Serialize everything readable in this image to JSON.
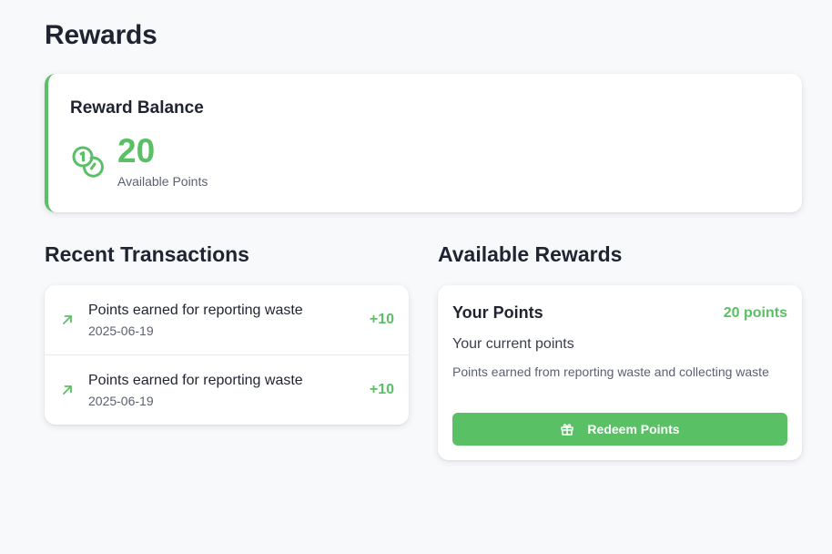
{
  "page": {
    "title": "Rewards"
  },
  "balance": {
    "title": "Reward Balance",
    "points": "20",
    "caption": "Available Points",
    "icon": "coins-icon",
    "accent_color": "#5ac066"
  },
  "transactions": {
    "section_title": "Recent Transactions",
    "items": [
      {
        "description": "Points earned for reporting waste",
        "date": "2025-06-19",
        "amount": "+10",
        "icon": "arrow-up-right-icon"
      },
      {
        "description": "Points earned for reporting waste",
        "date": "2025-06-19",
        "amount": "+10",
        "icon": "arrow-up-right-icon"
      }
    ]
  },
  "rewards": {
    "section_title": "Available Rewards",
    "items": [
      {
        "name": "Your Points",
        "points": "20 points",
        "subtitle": "Your current points",
        "description": "Points earned from reporting waste and collecting waste",
        "button_label": "Redeem Points",
        "button_icon": "gift-icon"
      }
    ]
  }
}
